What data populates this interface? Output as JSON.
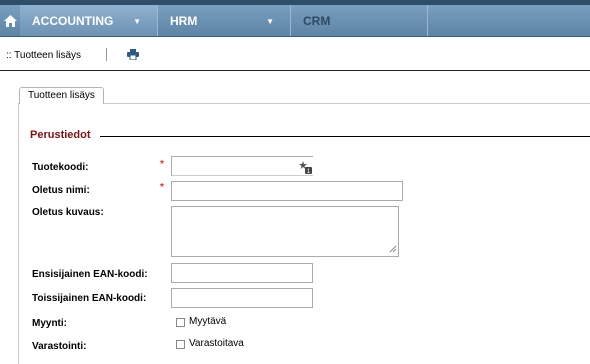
{
  "nav": {
    "items": [
      {
        "label": "ACCOUNTING"
      },
      {
        "label": "HRM"
      },
      {
        "label": "CRM"
      }
    ]
  },
  "toolbar": {
    "breadcrumb": ":: Tuotteen lisäys"
  },
  "tab": {
    "label": "Tuotteen lisäys"
  },
  "section": {
    "legend": "Perustiedot"
  },
  "form": {
    "required_mark": "*",
    "tuotekoodi": {
      "label": "Tuotekoodi:",
      "value": ""
    },
    "oletus_nimi": {
      "label": "Oletus nimi:",
      "value": ""
    },
    "oletus_kuvaus": {
      "label": "Oletus kuvaus:",
      "value": ""
    },
    "ean1": {
      "label": "Ensisijainen EAN-koodi:",
      "value": ""
    },
    "ean2": {
      "label": "Toissijainen EAN-koodi:",
      "value": ""
    },
    "myynti": {
      "label": "Myynti:",
      "checkbox_label": "Myytävä",
      "checked": false
    },
    "varastointi": {
      "label": "Varastointi:",
      "checkbox_label": "Varastoitava",
      "checked": false
    }
  },
  "colors": {
    "nav_bg": "#6c91b2",
    "legend": "#7a1212",
    "required": "#e0332b"
  }
}
